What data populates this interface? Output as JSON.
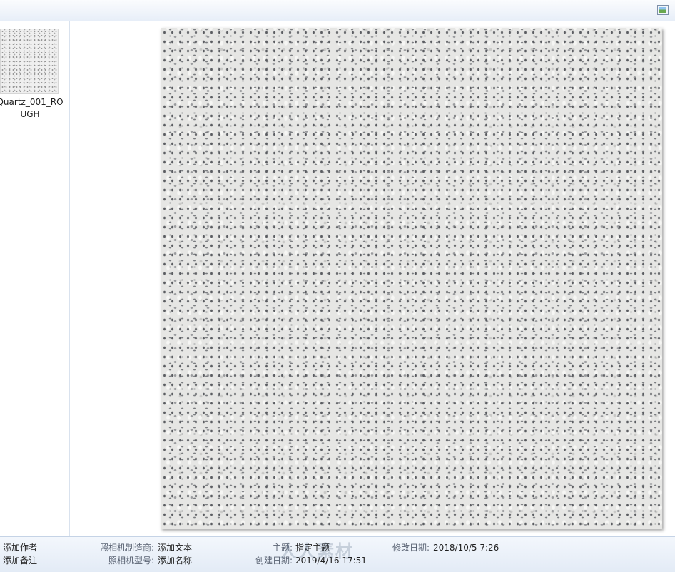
{
  "file": {
    "name": "Quartz_001_ROUGH"
  },
  "toolbar": {
    "preview_icon": "preview-pane-icon"
  },
  "details": {
    "author_placeholder": "添加作者",
    "comment_placeholder": "添加备注",
    "camera_maker_label": "照相机制造商:",
    "camera_maker_value": "添加文本",
    "camera_model_label": "照相机型号:",
    "camera_model_value": "添加名称",
    "subject_label": "主题:",
    "subject_value": "指定主题",
    "date_modified_label": "修改日期:",
    "date_modified_value": "2018/10/5 7:26",
    "date_created_label": "创建日期:",
    "date_created_value": "2019/4/16 17:51"
  },
  "watermark": {
    "text": "人人素材"
  }
}
